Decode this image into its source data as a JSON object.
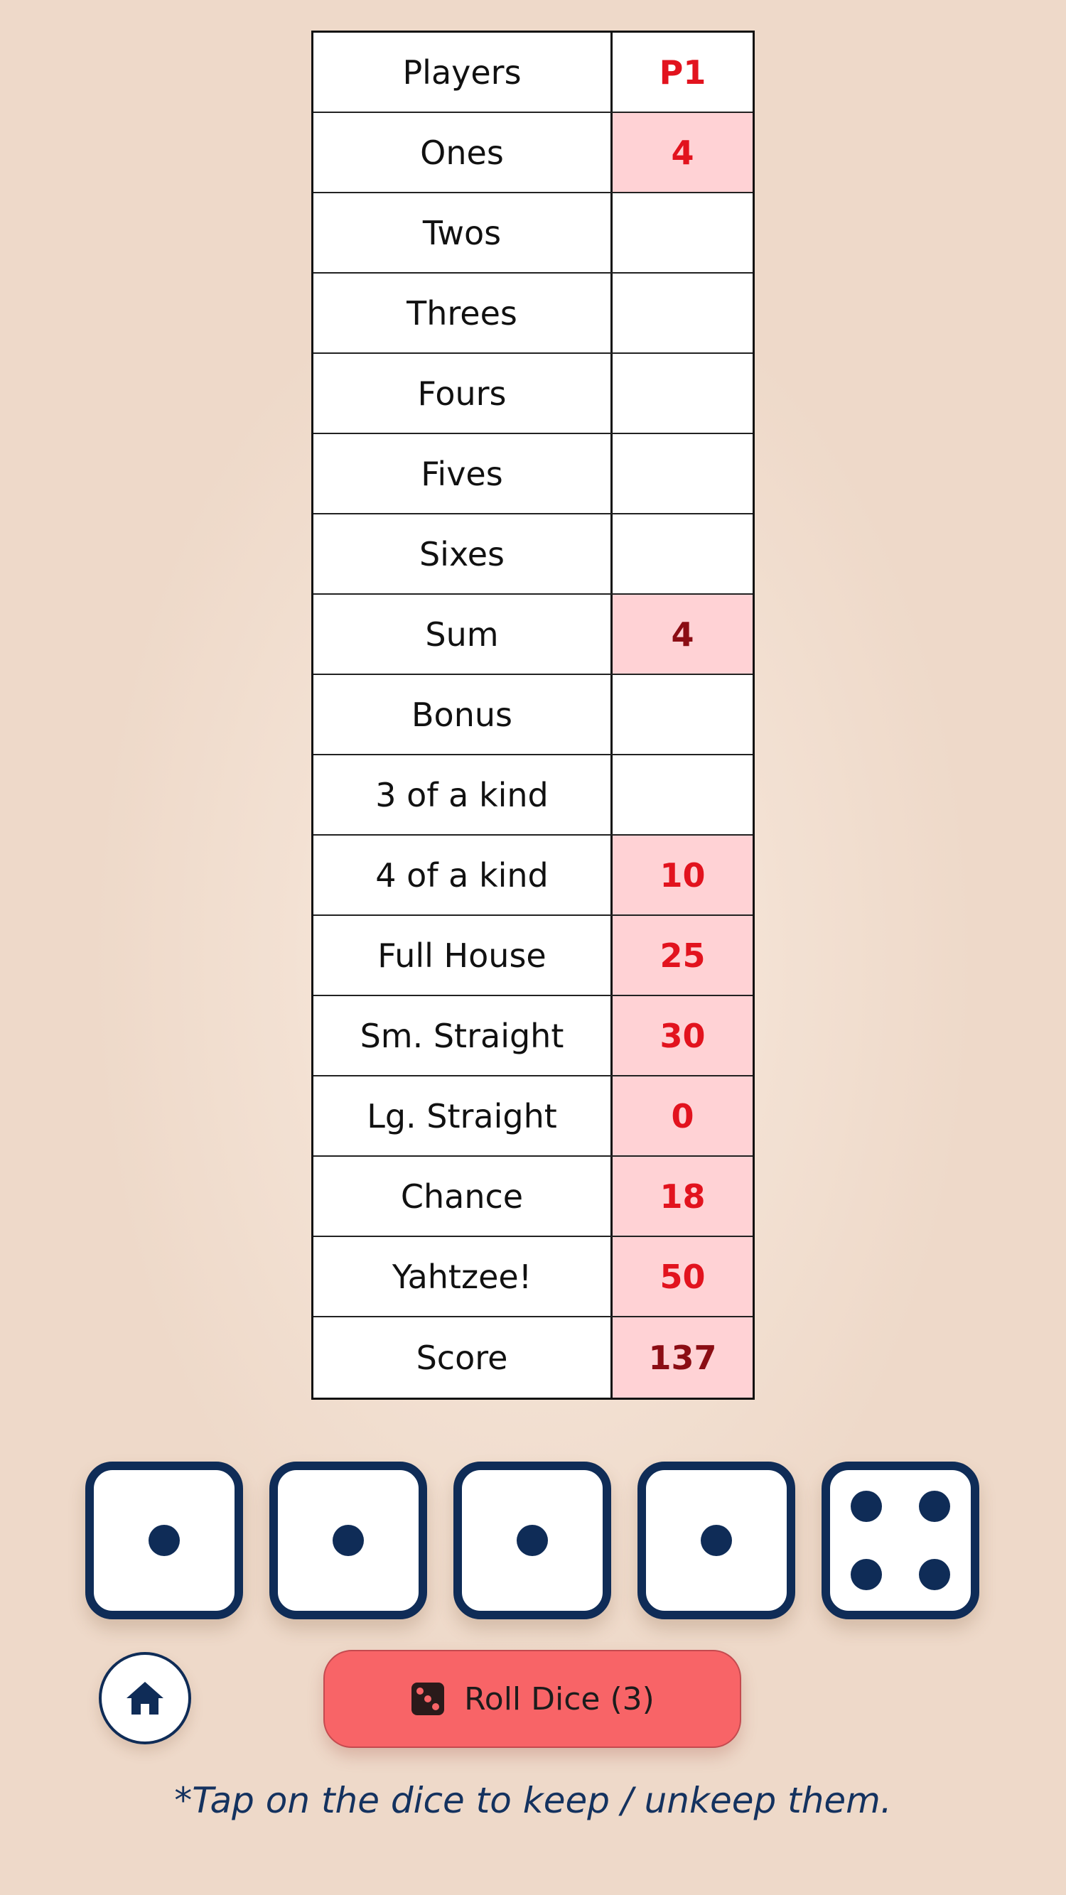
{
  "scorecard": {
    "header": {
      "label": "Players",
      "player": "P1"
    },
    "rows": [
      {
        "label": "Ones",
        "value": "4",
        "state": "filled"
      },
      {
        "label": "Twos",
        "value": "",
        "state": "empty"
      },
      {
        "label": "Threes",
        "value": "",
        "state": "empty"
      },
      {
        "label": "Fours",
        "value": "",
        "state": "empty"
      },
      {
        "label": "Fives",
        "value": "",
        "state": "empty"
      },
      {
        "label": "Sixes",
        "value": "",
        "state": "empty"
      },
      {
        "label": "Sum",
        "value": "4",
        "state": "computed"
      },
      {
        "label": "Bonus",
        "value": "",
        "state": "empty"
      },
      {
        "label": "3 of a kind",
        "value": "",
        "state": "empty"
      },
      {
        "label": "4 of a kind",
        "value": "10",
        "state": "filled"
      },
      {
        "label": "Full House",
        "value": "25",
        "state": "filled"
      },
      {
        "label": "Sm. Straight",
        "value": "30",
        "state": "filled"
      },
      {
        "label": "Lg. Straight",
        "value": "0",
        "state": "filled"
      },
      {
        "label": "Chance",
        "value": "18",
        "state": "filled"
      },
      {
        "label": "Yahtzee!",
        "value": "50",
        "state": "filled"
      },
      {
        "label": "Score",
        "value": "137",
        "state": "computed"
      }
    ]
  },
  "dice": [
    1,
    1,
    1,
    1,
    4
  ],
  "controls": {
    "home_icon": "home-icon",
    "roll_icon": "dice-icon",
    "roll_label": "Roll Dice (3)"
  },
  "hint": "*Tap on the dice to keep / unkeep them.",
  "colors": {
    "accent_navy": "#0f2c57",
    "score_red": "#e2131e",
    "filled_cell": "#ffd2d5",
    "roll_button": "#f86467"
  }
}
